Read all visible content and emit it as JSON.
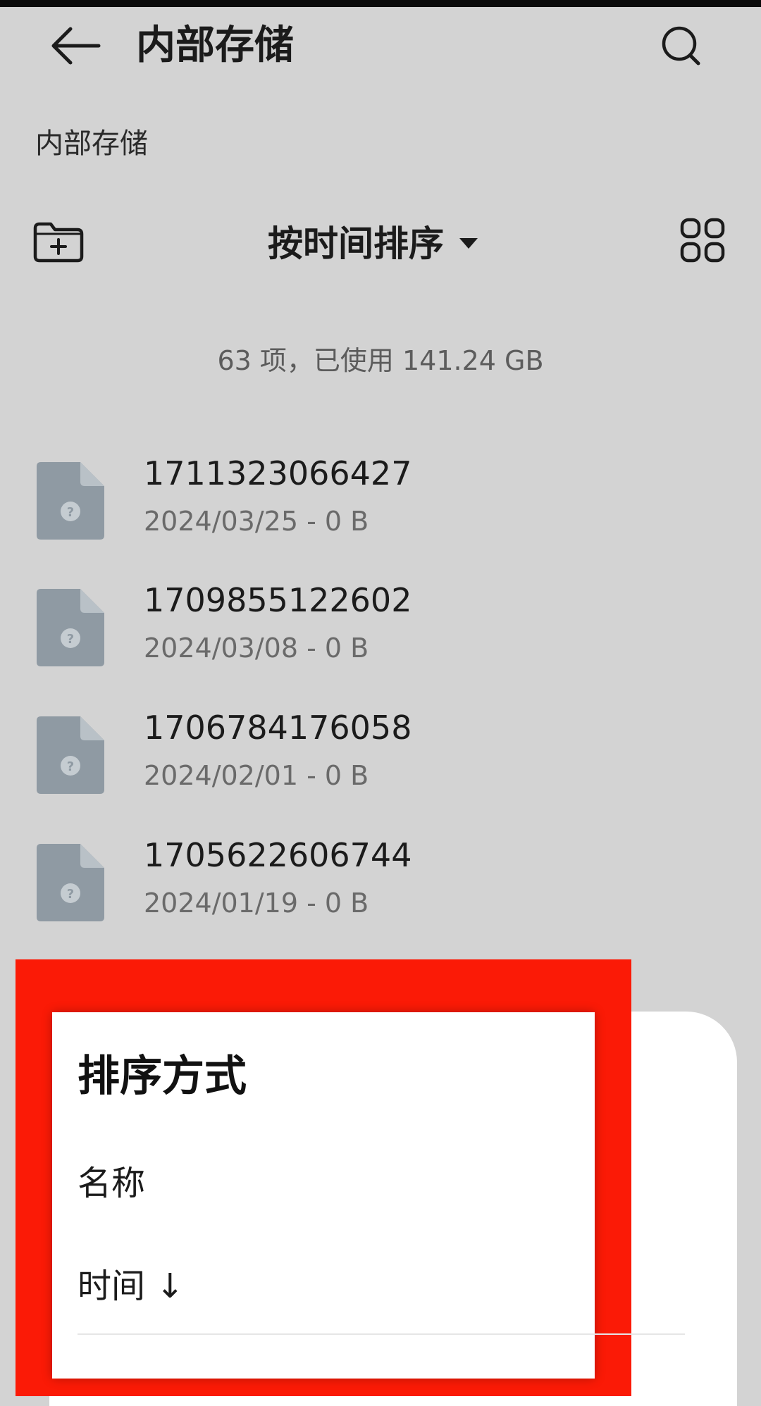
{
  "header": {
    "title": "内部存储",
    "back_icon": "arrow-left-icon",
    "search_icon": "search-icon"
  },
  "breadcrumb": "内部存储",
  "toolbar": {
    "new_folder_icon": "new-folder-icon",
    "sort_label": "按时间排序",
    "sort_caret_icon": "caret-down-icon",
    "view_icon": "grid-view-icon"
  },
  "summary": "63 项，已使用 141.24 GB",
  "files": [
    {
      "name": "1711323066427",
      "meta": "2024/03/25 - 0 B",
      "icon": "unknown-file-icon"
    },
    {
      "name": "1709855122602",
      "meta": "2024/03/08 - 0 B",
      "icon": "unknown-file-icon"
    },
    {
      "name": "1706784176058",
      "meta": "2024/02/01 - 0 B",
      "icon": "unknown-file-icon"
    },
    {
      "name": "1705622606744",
      "meta": "2024/01/19 - 0 B",
      "icon": "unknown-file-icon"
    }
  ],
  "sort_sheet": {
    "title": "排序方式",
    "options": [
      {
        "label": "名称"
      },
      {
        "label": "时间 ↓"
      }
    ]
  },
  "colors": {
    "background": "#d3d3d3",
    "highlight": "#fb1a06",
    "file_icon": "#8f9aa3"
  }
}
